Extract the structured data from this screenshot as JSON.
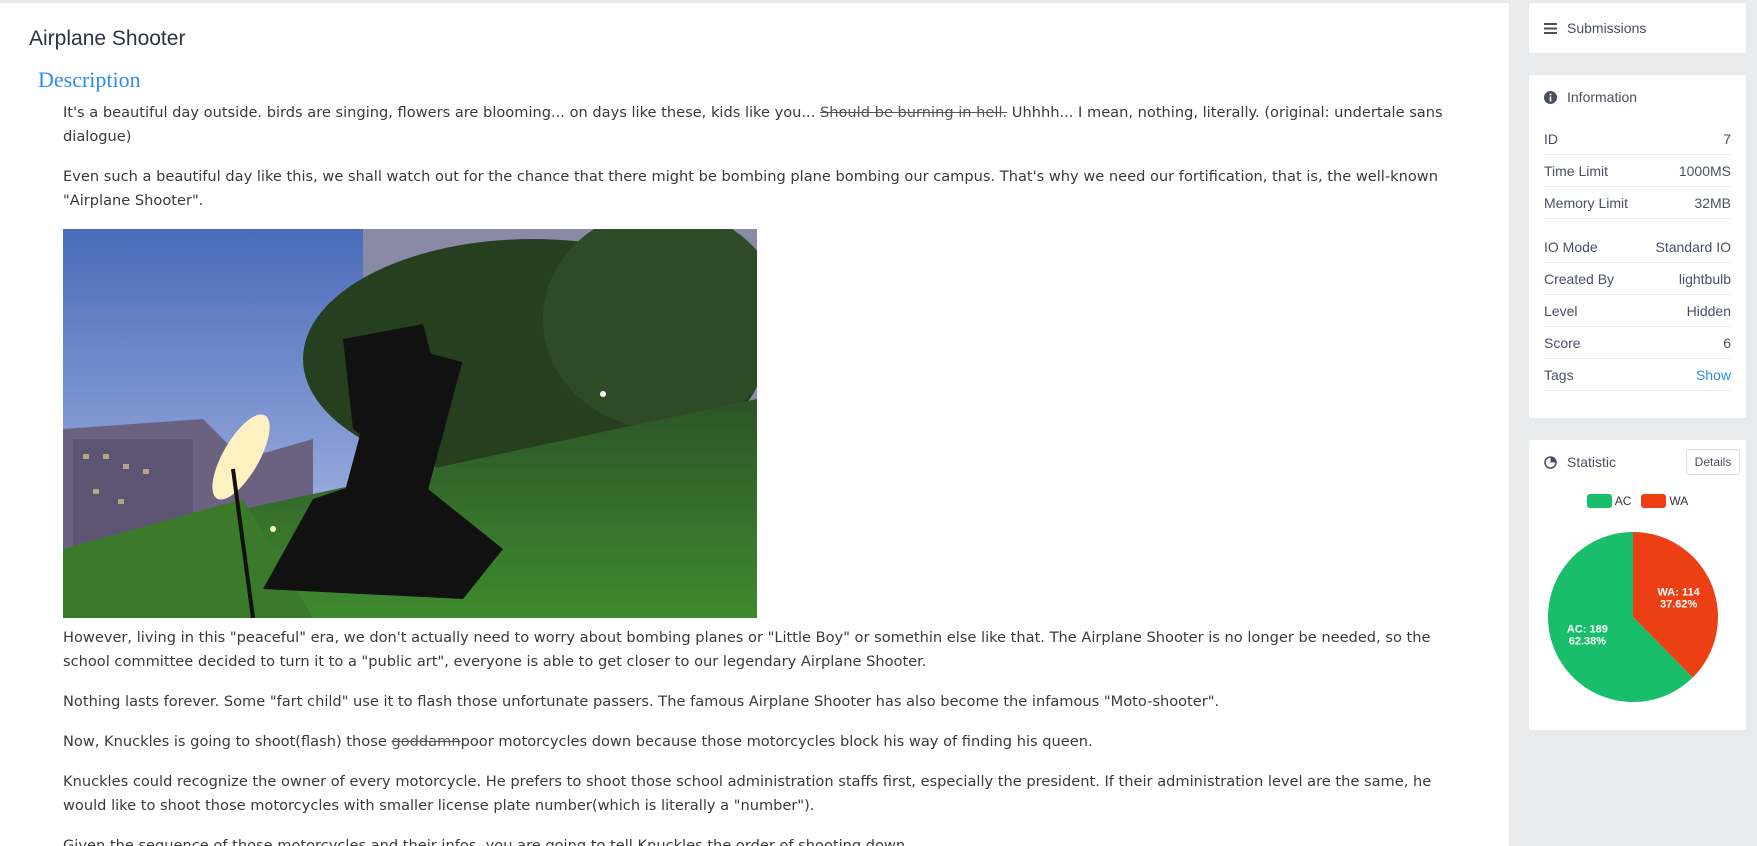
{
  "problem": {
    "title": "Airplane Shooter",
    "section": "Description",
    "paragraphs": [
      {
        "a": "It's a beautiful day outside. birds are singing, flowers are blooming... on days like these, kids like you... ",
        "strike": "Should be burning in hell.",
        "b": " Uhhhh... I mean, nothing, literally. (original: undertale sans dialogue)"
      },
      {
        "a": "Even such a beautiful day like this, we shall watch out for the chance that there might be bombing plane bombing our campus. That's why we need our fortification, that is, the well-known \"Airplane Shooter\"."
      },
      {
        "a": "However, living in this \"peaceful\" era, we don't actually need to worry about bombing planes or \"Little Boy\" or somethin else like that. The Airplane Shooter is no longer be needed, so the school committee decided to turn it to a \"public art\", everyone is able to get closer to our legendary Airplane Shooter."
      },
      {
        "a": "Nothing lasts forever. Some \"fart child\" use it to flash those unfortunate passers. The famous Airplane Shooter has also become the infamous \"Moto-shooter\"."
      },
      {
        "a": "Now, Knuckles is going to shoot(flash) those ",
        "strike": "goddamn",
        "b": "poor motorcycles down because those motorcycles block his way of finding his queen."
      },
      {
        "a": "Knuckles could recognize the owner of every motorcycle. He prefers to shoot those school administration staffs first, especially the president. If their administration level are the same, he would like to shoot those motorcycles with smaller license plate number(which is literally a \"number\")."
      },
      {
        "a": "Given the sequence of those motorcycles and their infos, you are going to tell Knuckles the order of shooting down."
      }
    ]
  },
  "sidebar": {
    "submissions_label": "Submissions",
    "information_label": "Information",
    "info": {
      "id_label": "ID",
      "id": "7",
      "time_label": "Time Limit",
      "time": "1000MS",
      "memory_label": "Memory Limit",
      "memory": "32MB",
      "io_label": "IO Mode",
      "io": "Standard IO",
      "created_label": "Created By",
      "created": "lightbulb",
      "level_label": "Level",
      "level": "Hidden",
      "score_label": "Score",
      "score": "6",
      "tags_label": "Tags",
      "tags": "Show"
    },
    "statistic_label": "Statistic",
    "details_label": "Details"
  },
  "chart_data": {
    "type": "pie",
    "legend": [
      "AC",
      "WA"
    ],
    "slices": [
      {
        "name": "AC",
        "value": 189,
        "label": "AC: 189",
        "percent": "62.38%",
        "color": "#19be6b"
      },
      {
        "name": "WA",
        "value": 114,
        "label": "WA: 114",
        "percent": "37.62%",
        "color": "#ed3f14"
      }
    ]
  },
  "colors": {
    "accent": "#2d8cf0",
    "ac": "#19be6b",
    "wa": "#ed3f14"
  }
}
